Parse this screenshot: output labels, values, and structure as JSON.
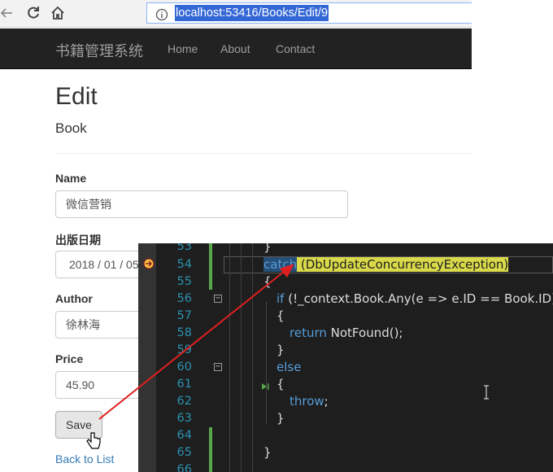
{
  "browser": {
    "url": "localhost:53416/Books/Edit/9",
    "back_icon": "arrow-left-icon",
    "reload_icon": "reload-icon",
    "home_icon": "home-icon",
    "info_icon": "info-icon"
  },
  "navbar": {
    "brand": "书籍管理系统",
    "links": [
      "Home",
      "About",
      "Contact"
    ],
    "background": "#222222"
  },
  "page": {
    "title": "Edit",
    "subtitle": "Book"
  },
  "form": {
    "name_label": "Name",
    "name_value": "微信营销",
    "date_label": "出版日期",
    "date_value": "2018 / 01 / 05",
    "author_label": "Author",
    "author_value": "徐林海",
    "price_label": "Price",
    "price_value": "45.90",
    "save_label": "Save",
    "back_link": "Back to List"
  },
  "editor": {
    "background": "#1e1e1e",
    "lines": [
      {
        "num": "53",
        "code": "}"
      },
      {
        "num": "54",
        "code_kw": "catch",
        "code_rest": " (DbUpdateConcurrencyException)"
      },
      {
        "num": "55",
        "code": "{"
      },
      {
        "num": "56",
        "code_kw": "if",
        "code_rest": " (!_context.Book.Any(e => e.ID == Book.ID))"
      },
      {
        "num": "57",
        "code": "{"
      },
      {
        "num": "58",
        "code_kw": "return",
        "code_rest": " NotFound();"
      },
      {
        "num": "59",
        "code": "}"
      },
      {
        "num": "60",
        "code_kw": "else",
        "code_rest": ""
      },
      {
        "num": "61",
        "code": "{"
      },
      {
        "num": "62",
        "code_kw": "throw",
        "code_rest": ";"
      },
      {
        "num": "63",
        "code": "}"
      },
      {
        "num": "64",
        "code": ""
      },
      {
        "num": "65",
        "code": "}"
      },
      {
        "num": "66",
        "code": ""
      }
    ],
    "current_line": "54",
    "breakpoint_icon": "current-statement-arrow-icon"
  },
  "annotation": {
    "arrow_color": "#e02020"
  }
}
